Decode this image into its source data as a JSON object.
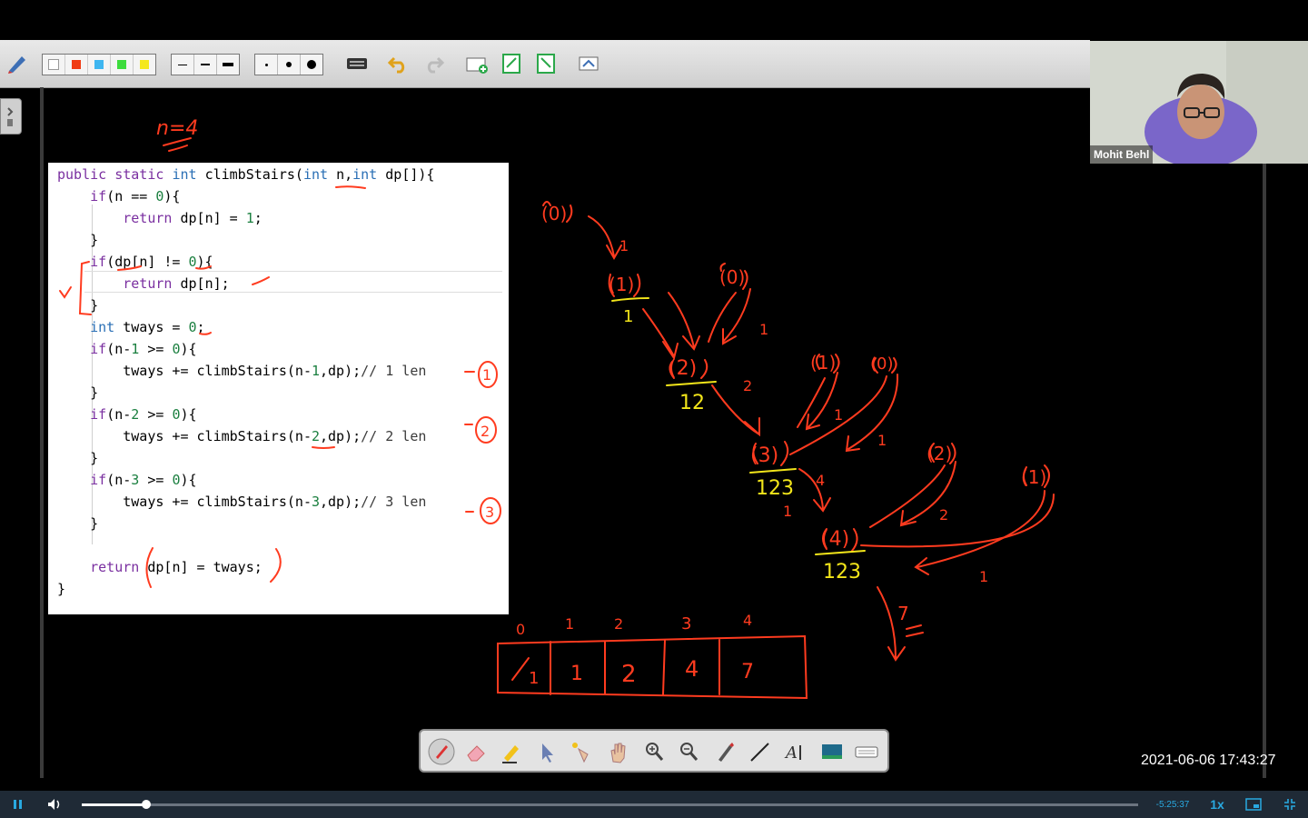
{
  "toolbar": {
    "colors": [
      "#ffffff",
      "#f03c14",
      "#3fb6f0",
      "#3ddc3d",
      "#f4e81c"
    ],
    "line_widths": [
      "thin",
      "medium",
      "thick"
    ],
    "dot_sizes": [
      "small",
      "medium",
      "large"
    ],
    "icons": [
      "pen-settings-icon",
      "keyboard-icon",
      "undo-icon",
      "redo-icon",
      "add-page-icon",
      "previous-page-icon",
      "next-page-icon",
      "screen-capture-icon"
    ]
  },
  "code": {
    "lines": [
      "public static int climbStairs(int n,int dp[]){",
      "    if(n == 0){",
      "        return dp[n] = 1;",
      "    }",
      "    if(dp[n] != 0){",
      "        return dp[n];",
      "    }",
      "    int tways = 0;",
      "    if(n-1 >= 0){",
      "        tways += climbStairs(n-1,dp);// 1 len",
      "    }",
      "    if(n-2 >= 0){",
      "        tways += climbStairs(n-2,dp);// 2 len",
      "    }",
      "    if(n-3 >= 0){",
      "        tways += climbStairs(n-3,dp);// 3 len",
      "    }",
      "",
      "    return dp[n] = tways;",
      "}"
    ]
  },
  "annotations": {
    "n_label": "n=4",
    "branch_marks": [
      "1",
      "2",
      "3"
    ],
    "tree_nodes": [
      "(0)",
      "(1)",
      "(0)",
      "(2)",
      "(1)",
      "(0)",
      "(3)",
      "(2)",
      "(1)",
      "(4)"
    ],
    "node_values": [
      "1",
      "12",
      "123",
      "123"
    ],
    "edge_labels": [
      "1",
      "1",
      "2",
      "1",
      "1",
      "4",
      "1",
      "2",
      "1"
    ],
    "result": "7",
    "array_indices": [
      "0",
      "1",
      "2",
      "3",
      "4"
    ],
    "array_values": [
      "1",
      "1",
      "2",
      "4",
      "7"
    ]
  },
  "webcam": {
    "name": "Mohit Behl"
  },
  "floating_tools": [
    "pen-icon",
    "eraser-icon",
    "highlighter-icon",
    "pointer-icon",
    "magic-pointer-icon",
    "hand-icon",
    "zoom-in-icon",
    "zoom-out-icon",
    "brush-icon",
    "line-icon",
    "text-icon",
    "background-icon",
    "keyboard-icon"
  ],
  "timestamp": "2021-06-06  17:43:27",
  "player": {
    "time_remaining": "-5:25:37",
    "speed": "1x",
    "progress": 0.061
  },
  "colors": {
    "ink_red": "#ff3b1f",
    "ink_yellow": "#f2e51a",
    "accent_blue": "#29a9e0"
  }
}
